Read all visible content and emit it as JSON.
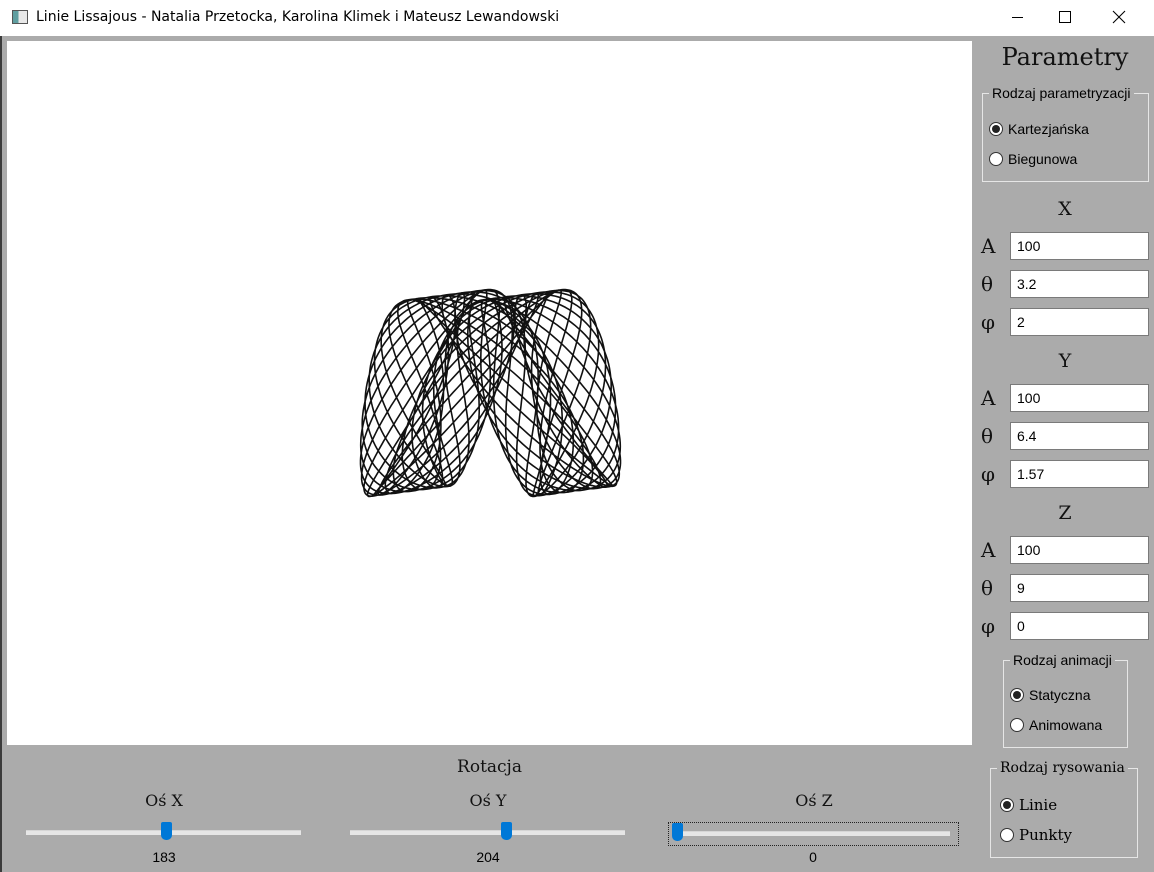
{
  "window": {
    "title": "Linie Lissajous - Natalia Przetocka, Karolina Klimek i Mateusz Lewandowski",
    "controls": [
      "minimize-icon",
      "maximize-icon",
      "close-icon"
    ]
  },
  "panel": {
    "title": "Parametry",
    "parametrization": {
      "legend": "Rodzaj parametryzacji",
      "options": [
        {
          "label": "Kartezjańska",
          "checked": true
        },
        {
          "label": "Biegunowa",
          "checked": false
        }
      ]
    },
    "x": {
      "heading": "X",
      "a_label": "A",
      "theta_label": "θ",
      "phi_label": "φ",
      "a": "100",
      "theta": "3.2",
      "phi": "2"
    },
    "y": {
      "heading": "Y",
      "a_label": "A",
      "theta_label": "θ",
      "phi_label": "φ",
      "a": "100",
      "theta": "6.4",
      "phi": "1.57"
    },
    "z": {
      "heading": "Z",
      "a_label": "A",
      "theta_label": "θ",
      "phi_label": "φ",
      "a": "100",
      "theta": "9",
      "phi": "0"
    },
    "animation": {
      "legend": "Rodzaj animacji",
      "options": [
        {
          "label": "Statyczna",
          "checked": true
        },
        {
          "label": "Animowana",
          "checked": false
        }
      ]
    },
    "drawing": {
      "legend": "Rodzaj rysowania",
      "options": [
        {
          "label": "Linie",
          "checked": true
        },
        {
          "label": "Punkty",
          "checked": false
        }
      ]
    }
  },
  "rotation": {
    "title": "Rotacja",
    "x": {
      "label": "Oś X",
      "value": "183",
      "max": 360
    },
    "y": {
      "label": "Oś Y",
      "value": "204",
      "max": 360
    },
    "z": {
      "label": "Oś Z",
      "value": "0",
      "max": 360
    }
  },
  "colors": {
    "accent": "#0078d7",
    "panel_bg": "#ababab",
    "canvas_bg": "#ffffff",
    "curve": "#111111"
  }
}
